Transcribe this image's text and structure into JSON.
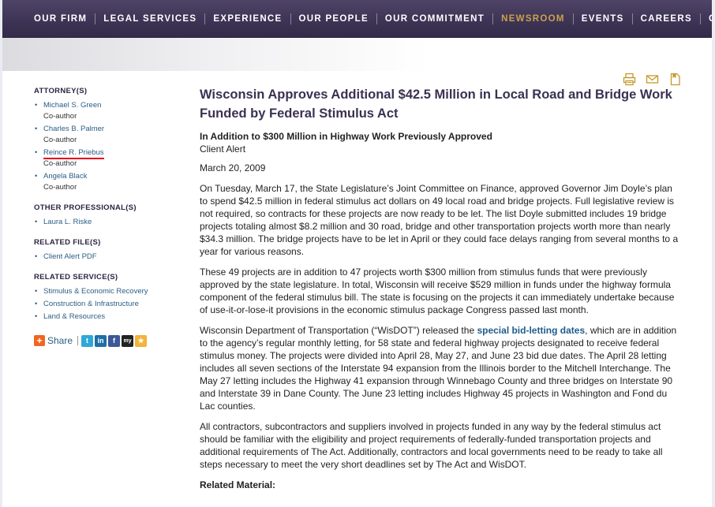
{
  "nav": {
    "items": [
      {
        "label": "OUR FIRM"
      },
      {
        "label": "LEGAL SERVICES"
      },
      {
        "label": "EXPERIENCE"
      },
      {
        "label": "OUR PEOPLE"
      },
      {
        "label": "OUR COMMITMENT"
      },
      {
        "label": "NEWSROOM"
      },
      {
        "label": "EVENTS"
      },
      {
        "label": "CAREERS"
      },
      {
        "label": "OFFICES"
      }
    ],
    "active_color": "#caa24c"
  },
  "sidebar": {
    "attorneys_heading": "ATTORNEY(S)",
    "attorneys": [
      {
        "name": "Michael S. Green",
        "role": "Co-author"
      },
      {
        "name": "Charles B. Palmer",
        "role": "Co-author"
      },
      {
        "name": "Reince R. Priebus",
        "role": "Co-author"
      },
      {
        "name": "Angela Black",
        "role": "Co-author"
      }
    ],
    "professionals_heading": "OTHER PROFESSIONAL(S)",
    "professionals": [
      "Laura L. Riske"
    ],
    "files_heading": "RELATED FILE(S)",
    "files": [
      "Client Alert PDF"
    ],
    "services_heading": "RELATED SERVICE(S)",
    "services": [
      "Stimulus & Economic Recovery",
      "Construction & Infrastructure",
      "Land & Resources"
    ],
    "share_label": "Share",
    "share_icons": [
      "twitter-icon",
      "linkedin-icon",
      "facebook-icon",
      "myspace-icon",
      "favorites-icon"
    ]
  },
  "tools": {
    "icons": [
      "print-icon",
      "email-icon",
      "save-document-icon"
    ]
  },
  "article": {
    "title": "Wisconsin Approves Additional $42.5 Million in Local Road and Bridge Work Funded by Federal Stimulus Act",
    "subtitle": "In Addition to $300 Million in Highway Work Previously Approved",
    "type": "Client Alert",
    "date": "March 20, 2009",
    "p1": "On Tuesday, March 17, the State Legislature’s Joint Committee on Finance, approved Governor Jim Doyle’s plan to spend $42.5 million in federal stimulus act dollars on 49 local road and bridge projects. Full legislative review is not required, so contracts for these projects are now ready to be let. The list Doyle submitted includes 19 bridge projects totaling almost $8.2 million and 30 road, bridge and other transportation projects worth more than nearly $34.3 million. The bridge projects have to be let in April or they could face delays ranging from several months to a year for various reasons.",
    "p2": "These 49 projects are in addition to 47 projects worth $300 million from stimulus funds that were previously approved by the state legislature. In total, Wisconsin will receive $529 million in funds under the highway formula component of the federal stimulus bill. The state is focusing on the projects it can immediately undertake because of use-it-or-lose-it provisions in the economic stimulus package Congress passed last month.",
    "p3_before": "Wisconsin Department of Transportation (“WisDOT”) released the ",
    "p3_link": "special bid-letting dates",
    "p3_after": ", which are in addition to the agency’s regular monthly letting, for 58 state and federal highway projects designated to receive federal stimulus money. The projects were divided into April 28, May 27, and June 23 bid due dates. The April 28 letting includes all seven sections of the Interstate 94 expansion from the Illinois border to the Mitchell Interchange. The May 27 letting includes the Highway 41 expansion through Winnebago County and three bridges on Interstate 90 and Interstate 39 in Dane County. The June 23 letting includes Highway 45 projects in Washington and Fond du Lac counties.",
    "p4": "All contractors, subcontractors and suppliers involved in projects funded in any way by the federal stimulus act should be familiar with the eligibility and project requirements of federally-funded transportation projects and additional requirements of The Act. Additionally, contractors and local governments need to be ready to take all steps necessary to meet the very short deadlines set by The Act and WisDOT.",
    "related_label": "Related Material:"
  }
}
